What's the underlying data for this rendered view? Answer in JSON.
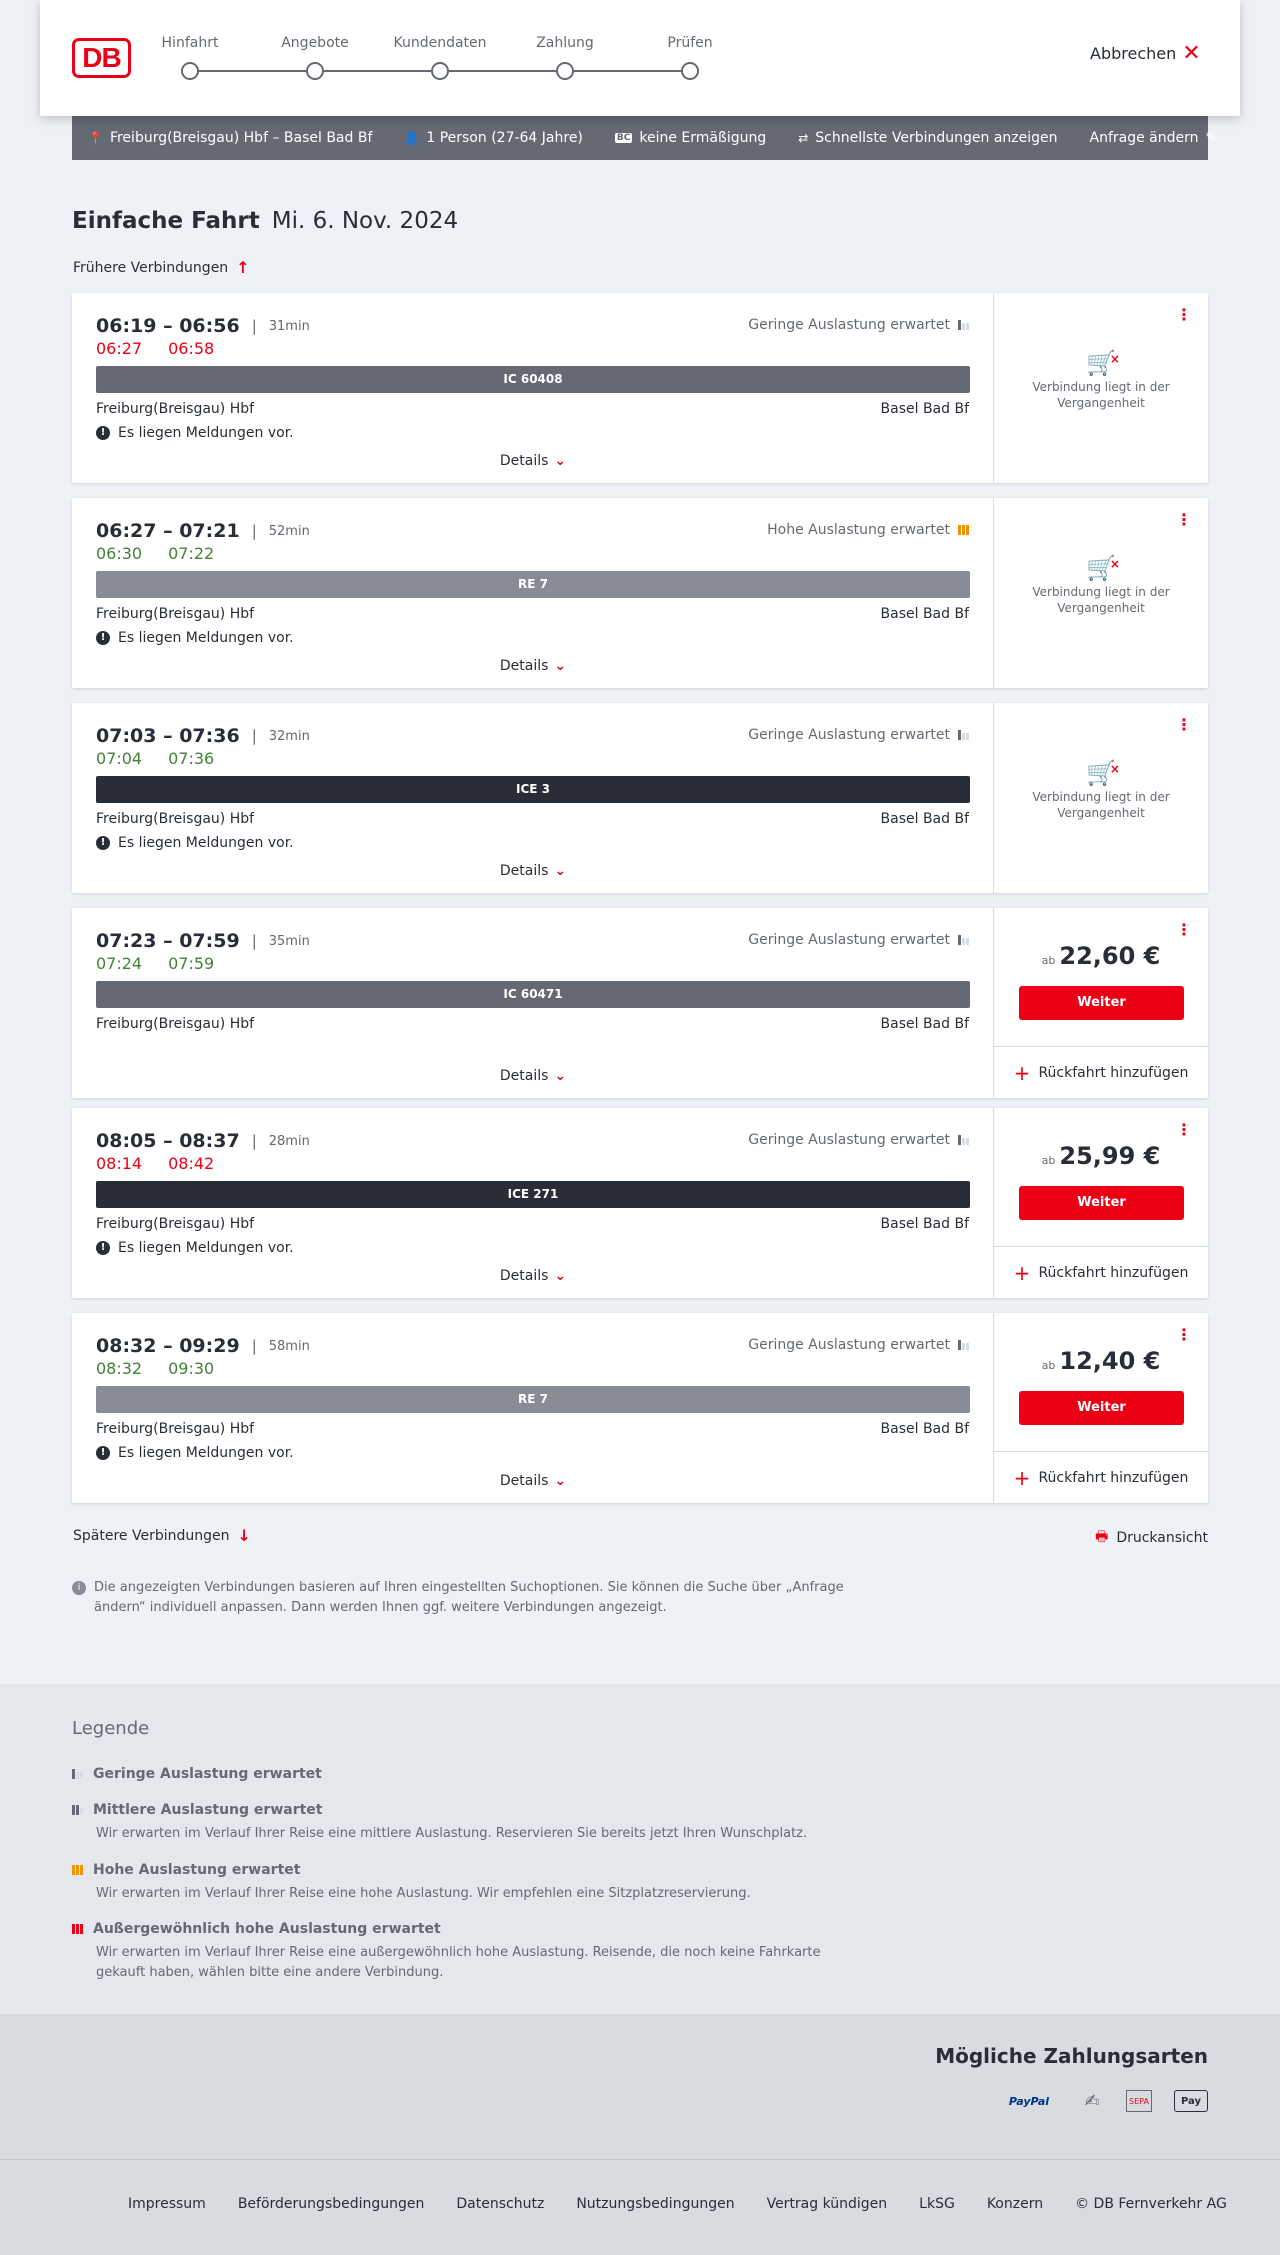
{
  "header": {
    "logo_text": "DB",
    "steps": [
      {
        "label": "Hinfahrt",
        "active": true
      },
      {
        "label": "Angebote",
        "active": false
      },
      {
        "label": "Kundendaten",
        "active": false
      },
      {
        "label": "Zahlung",
        "active": false
      },
      {
        "label": "Prüfen",
        "active": false
      }
    ],
    "cancel_label": "Abbrechen"
  },
  "request_bar": {
    "route": "Freiburg(Breisgau) Hbf – Basel Bad Bf",
    "travellers": "1 Person (27-64 Jahre)",
    "discount_badge": "BC",
    "discount": "keine Ermäßigung",
    "fastest": "Schnellste Verbindungen anzeigen",
    "change": "Anfrage ändern"
  },
  "page": {
    "trip_type": "Einfache Fahrt",
    "date": "Mi. 6. Nov. 2024",
    "earlier": "Frühere Verbindungen",
    "later": "Spätere Verbindungen",
    "print": "Druckansicht",
    "info": "Die angezeigten Verbindungen basieren auf Ihren eingestellten Suchoptionen. Sie können die Suche über „Anfrage ändern“ individuell anpassen. Dann werden Ihnen ggf. weitere Verbindungen angezeigt."
  },
  "connections": [
    {
      "times": "06:19 – 06:56",
      "duration": "31min",
      "rt_dep": "06:27",
      "rt_arr": "06:58",
      "rt_dep_late": true,
      "rt_arr_late": true,
      "load": "Geringe Auslastung erwartet",
      "load_level": 1,
      "train": "IC 60408",
      "train_type": "ic",
      "from": "Freiburg(Breisgau) Hbf",
      "to": "Basel Bad Bf",
      "message": "Es liegen Meldungen vor.",
      "details": "Details",
      "past": true,
      "past_text": "Verbindung liegt in der Vergangenheit"
    },
    {
      "times": "06:27 – 07:21",
      "duration": "52min",
      "rt_dep": "06:30",
      "rt_arr": "07:22",
      "rt_dep_late": false,
      "rt_arr_late": false,
      "load": "Hohe Auslastung erwartet",
      "load_level": 3,
      "train": "RE 7",
      "train_type": "re",
      "from": "Freiburg(Breisgau) Hbf",
      "to": "Basel Bad Bf",
      "message": "Es liegen Meldungen vor.",
      "details": "Details",
      "past": true,
      "past_text": "Verbindung liegt in der Vergangenheit"
    },
    {
      "times": "07:03 – 07:36",
      "duration": "32min",
      "rt_dep": "07:04",
      "rt_arr": "07:36",
      "rt_dep_late": false,
      "rt_arr_late": false,
      "load": "Geringe Auslastung erwartet",
      "load_level": 1,
      "train": "ICE 3",
      "train_type": "ice",
      "from": "Freiburg(Breisgau) Hbf",
      "to": "Basel Bad Bf",
      "message": "Es liegen Meldungen vor.",
      "details": "Details",
      "past": true,
      "past_text": "Verbindung liegt in der Vergangenheit"
    },
    {
      "times": "07:23 – 07:59",
      "duration": "35min",
      "rt_dep": "07:24",
      "rt_arr": "07:59",
      "rt_dep_late": false,
      "rt_arr_late": false,
      "load": "Geringe Auslastung erwartet",
      "load_level": 1,
      "train": "IC 60471",
      "train_type": "ic",
      "from": "Freiburg(Breisgau) Hbf",
      "to": "Basel Bad Bf",
      "message": "",
      "details": "Details",
      "past": false,
      "price_prefix": "ab",
      "price": "22,60 €",
      "button": "Weiter",
      "return": "Rückfahrt hinzufügen"
    },
    {
      "times": "08:05 – 08:37",
      "duration": "28min",
      "rt_dep": "08:14",
      "rt_arr": "08:42",
      "rt_dep_late": true,
      "rt_arr_late": true,
      "load": "Geringe Auslastung erwartet",
      "load_level": 1,
      "train": "ICE 271",
      "train_type": "ice",
      "from": "Freiburg(Breisgau) Hbf",
      "to": "Basel Bad Bf",
      "message": "Es liegen Meldungen vor.",
      "details": "Details",
      "past": false,
      "price_prefix": "ab",
      "price": "25,99 €",
      "button": "Weiter",
      "return": "Rückfahrt hinzufügen"
    },
    {
      "times": "08:32 – 09:29",
      "duration": "58min",
      "rt_dep": "08:32",
      "rt_arr": "09:30",
      "rt_dep_late": false,
      "rt_arr_late": false,
      "load": "Geringe Auslastung erwartet",
      "load_level": 1,
      "train": "RE 7",
      "train_type": "re",
      "from": "Freiburg(Breisgau) Hbf",
      "to": "Basel Bad Bf",
      "message": "Es liegen Meldungen vor.",
      "details": "Details",
      "past": false,
      "price_prefix": "ab",
      "price": "12,40 €",
      "button": "Weiter",
      "return": "Rückfahrt hinzufügen"
    }
  ],
  "legend": {
    "title": "Legende",
    "items": [
      {
        "title": "Geringe Auslastung erwartet",
        "text": "",
        "level": 1
      },
      {
        "title": "Mittlere Auslastung erwartet",
        "text": "Wir erwarten im Verlauf Ihrer Reise eine mittlere Auslastung. Reservieren Sie bereits jetzt Ihren Wunschplatz.",
        "level": 2
      },
      {
        "title": "Hohe Auslastung erwartet",
        "text": "Wir erwarten im Verlauf Ihrer Reise eine hohe Auslastung. Wir empfehlen eine Sitzplatzreservierung.",
        "level": 3
      },
      {
        "title": "Außergewöhnlich hohe Auslastung erwartet",
        "text": "Wir erwarten im Verlauf Ihrer Reise eine außergewöhnlich hohe Auslastung. Reisende, die noch keine Fahrkarte gekauft haben, wählen bitte eine andere Verbindung.",
        "level": 4
      }
    ]
  },
  "payment": {
    "title": "Mögliche Zahlungsarten",
    "methods": [
      "PayPal",
      "SEPA",
      "Pay"
    ]
  },
  "footer": {
    "links": [
      "Impressum",
      "Beförderungsbedingungen",
      "Datenschutz",
      "Nutzungsbedingungen",
      "Vertrag kündigen",
      "LkSG",
      "Konzern",
      "© DB Fernverkehr AG"
    ]
  }
}
